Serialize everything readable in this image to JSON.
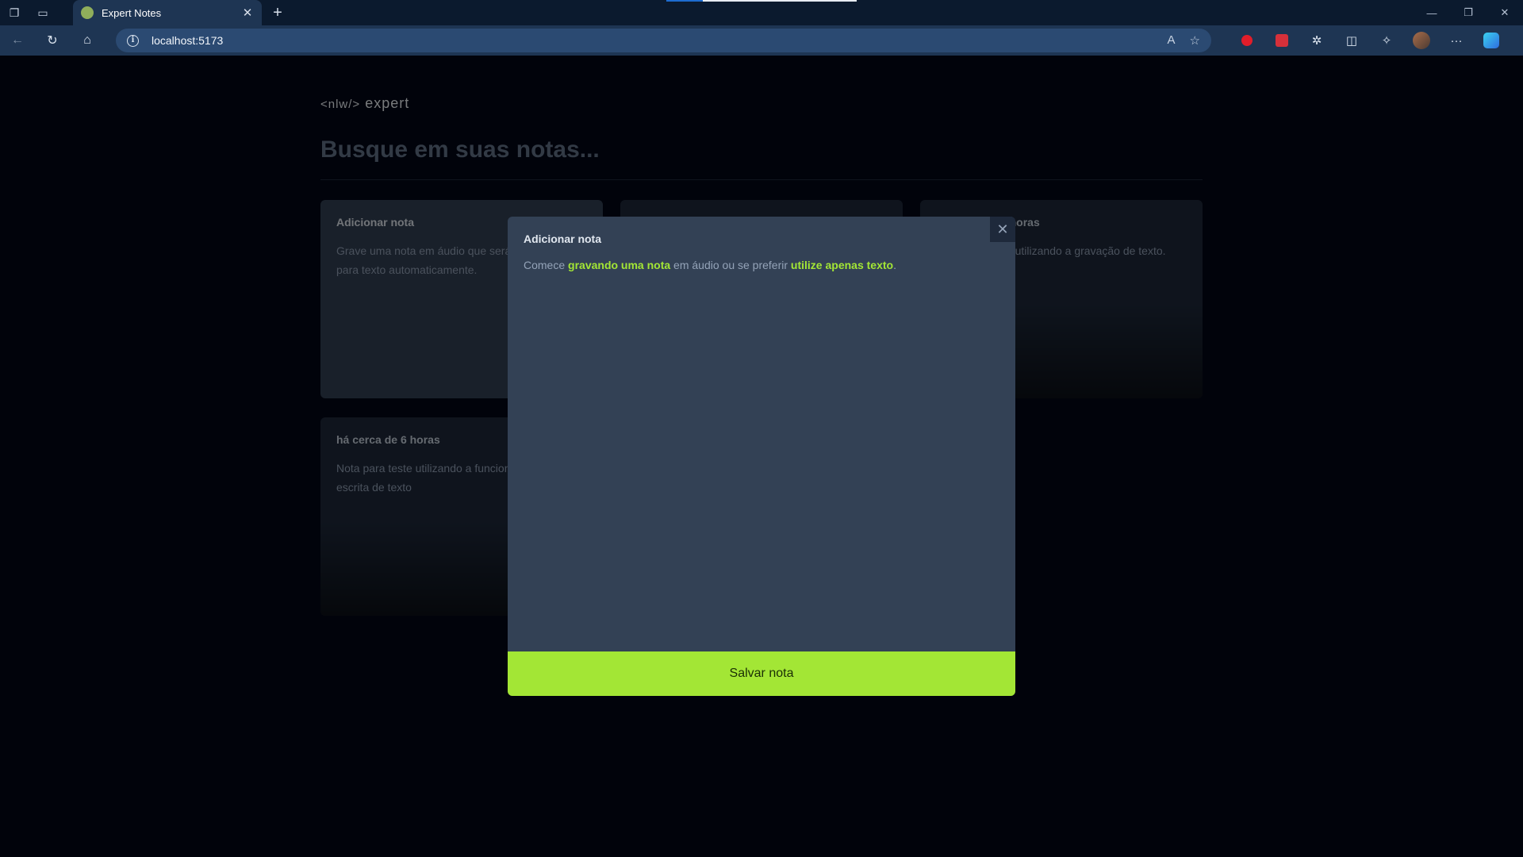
{
  "browser": {
    "tab_title": "Expert Notes",
    "url": "localhost:5173"
  },
  "app": {
    "logo_tag": "<nlw/>",
    "logo_text": "expert",
    "search_placeholder": "Busque em suas notas..."
  },
  "cards": {
    "add": {
      "title": "Adicionar nota",
      "body": "Grave uma nota em áudio que será convertida para texto automaticamente."
    },
    "note1": {
      "title": "há cerca de 6 horas",
      "body": "Nota para teste utilizando a gravação de texto."
    },
    "note2": {
      "title": "há cerca de 6 horas",
      "body": "Nota para teste utilizando a funcionalidade de escrita de texto"
    }
  },
  "modal": {
    "title": "Adicionar nota",
    "text_start": "Comece ",
    "link_audio": "gravando uma nota",
    "text_middle": " em áudio ou se preferir ",
    "link_text": "utilize apenas texto",
    "text_end": ".",
    "save_label": "Salvar nota"
  },
  "colors": {
    "accent": "#a3e635",
    "background": "#020617",
    "modal": "#334155"
  }
}
